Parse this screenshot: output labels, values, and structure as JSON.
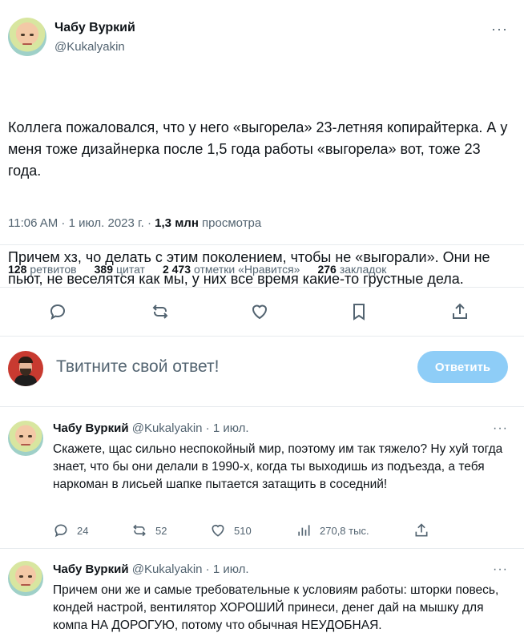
{
  "tweet": {
    "author_name": "Чабу Вуркий",
    "author_handle": "@Kukalyakin",
    "more": "···",
    "paragraphs": [
      "Коллега пожаловался, что у него «выгорела» 23-летняя копирайтерка. А у меня тоже дизайнерка после 1,5 года работы «выгорела» вот, тоже 23 года.",
      "Причем хз, чо делать с этим поколением, чтобы не «выгорали». Они не пьют, не веселятся как мы, у них все время какие-то грустные дела."
    ],
    "time_date": "11:06 AM · 1 июл. 2023 г. · ",
    "views_count": "1,3 млн",
    "views_label": " просмотра",
    "stats": [
      {
        "num": "128",
        "label": "ретвитов"
      },
      {
        "num": "389",
        "label": "цитат"
      },
      {
        "num": "2 473",
        "label": "отметки «Нравится»"
      },
      {
        "num": "276",
        "label": "закладок"
      }
    ],
    "actions": [
      "reply-icon",
      "retweet-icon",
      "like-icon",
      "bookmark-icon",
      "share-icon"
    ]
  },
  "compose": {
    "placeholder": "Твитните свой ответ!",
    "button": "Ответить"
  },
  "replies": [
    {
      "name": "Чабу Вуркий",
      "handle_date": "@Kukalyakin · 1 июл.",
      "text": "Скажете, щас сильно неспокойный мир, поэтому им так тяжело? Ну хуй тогда знает, что бы они делали в 1990-х, когда ты выходишь из подъезда, а тебя наркоман в лисьей шапке пытается затащить в соседний!",
      "replies": "24",
      "retweets": "52",
      "likes": "510",
      "views": "270,8 тыс."
    },
    {
      "name": "Чабу Вуркий",
      "handle_date": "@Kukalyakin · 1 июл.",
      "text": "Причем они же и самые требовательные к условиям работы: шторки повесь, кондей настрой, вентилятор ХОРОШИЙ принеси, денег дай на мышку для компа НА ДОРОГУЮ, потому что обычная НЕУДОБНАЯ."
    }
  ],
  "colors": {
    "text": "#0f1419",
    "secondary": "#536471",
    "accent_disabled": "#8ecdf7",
    "divider": "#e7ebee"
  }
}
